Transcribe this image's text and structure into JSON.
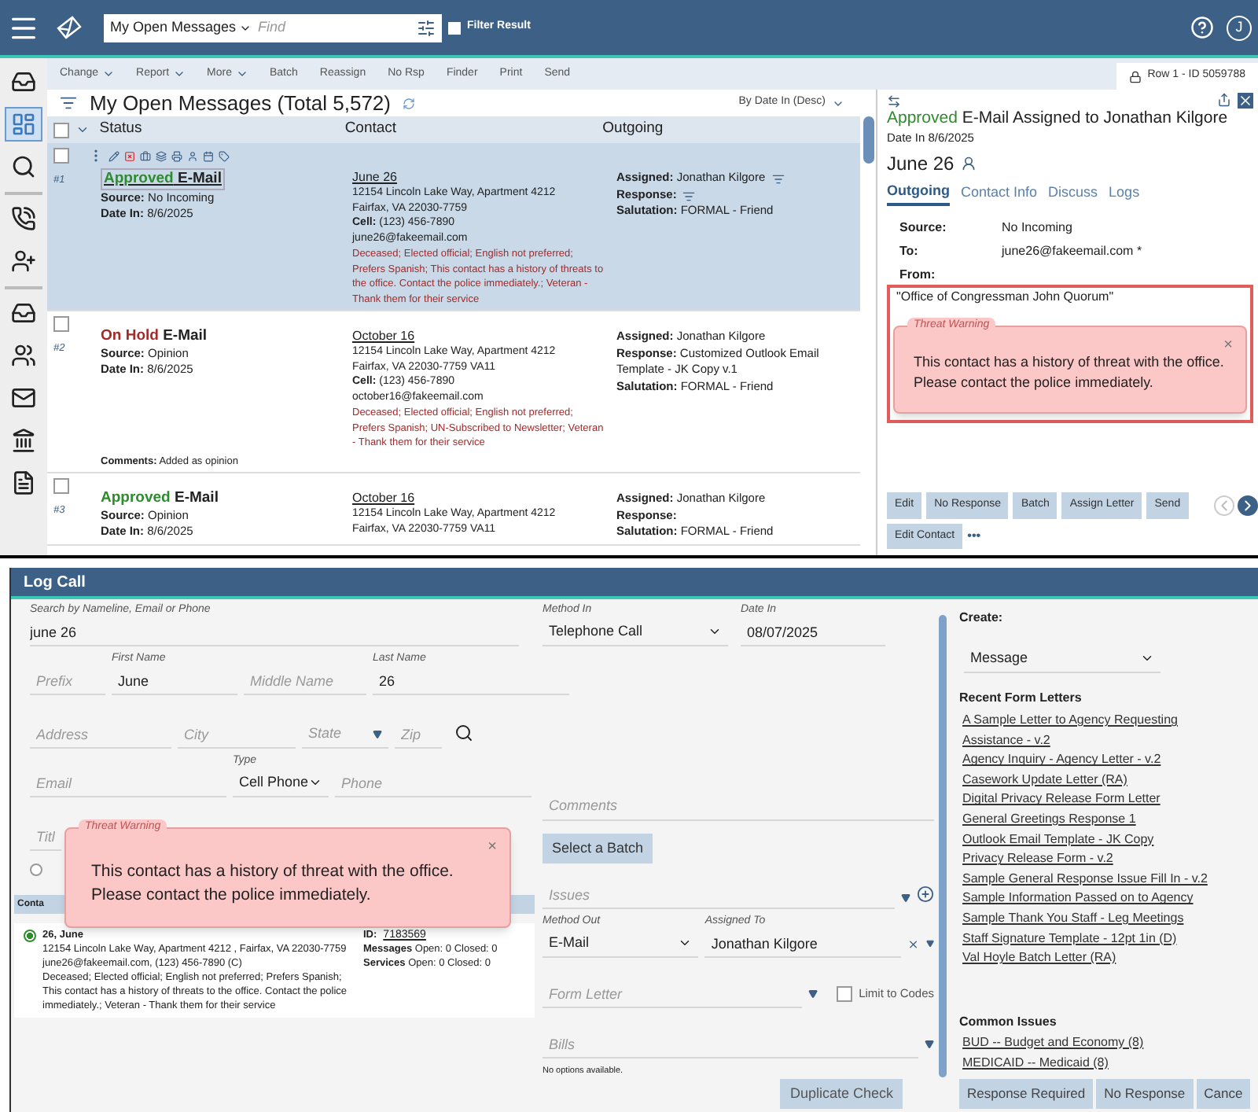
{
  "app_bar": {
    "view": "My Open Messages",
    "search_placeholder": "Find",
    "filter_result": {
      "label": "Filter Result",
      "checked": false
    },
    "user_initial": "J"
  },
  "sidebar": [
    {
      "kind": "inbox",
      "selected": false,
      "divider": false
    },
    {
      "kind": "dashboard",
      "selected": true,
      "divider": false
    },
    {
      "kind": "search",
      "selected": false,
      "divider": false
    },
    {
      "kind": "phone",
      "selected": false,
      "divider": true
    },
    {
      "kind": "add-user",
      "selected": false,
      "divider": false
    },
    {
      "kind": "inbox",
      "selected": false,
      "divider": true
    },
    {
      "kind": "users",
      "selected": false,
      "divider": false
    },
    {
      "kind": "mail",
      "selected": false,
      "divider": false
    },
    {
      "kind": "bank",
      "selected": false,
      "divider": false
    },
    {
      "kind": "document",
      "selected": false,
      "divider": false
    }
  ],
  "toolbar": [
    {
      "label": "Change",
      "menu": true
    },
    {
      "label": "Report",
      "menu": true
    },
    {
      "label": "More",
      "menu": true
    },
    {
      "label": "Batch",
      "menu": false
    },
    {
      "label": "Reassign",
      "menu": false
    },
    {
      "label": "No Rsp",
      "menu": false
    },
    {
      "label": "Finder",
      "menu": false
    },
    {
      "label": "Print",
      "menu": false
    },
    {
      "label": "Send",
      "menu": false
    }
  ],
  "row_indicator": "Row 1 - ID 5059788",
  "list": {
    "title": "My Open Messages (Total 5,572)",
    "sort": "By Date In (Desc)",
    "select_all_checked": false,
    "columns": [
      "Status",
      "Contact",
      "Outgoing"
    ],
    "rows": [
      {
        "number": "#1",
        "selected": true,
        "checked": false,
        "status": "Approved",
        "color": "#2e8b2e",
        "type": "E-Mail",
        "status_fields": [
          {
            "label": "Source:",
            "value": "No Incoming"
          },
          {
            "label": "Date In:",
            "value": "8/6/2025"
          }
        ],
        "contact": "June 26",
        "lines": [
          "12154 Lincoln Lake Way, Apartment 4212",
          "Fairfax, VA 22030-7759"
        ],
        "cell": {
          "label": "Cell:",
          "value": "(123) 456-7890"
        },
        "email": "june26@fakeemail.com",
        "notes": "Deceased; Elected official; English not preferred; Prefers Spanish; This contact has a history of threats to the office. Contact the police immediately.; Veteran - Thank them for their service",
        "outgoing": [
          {
            "label": "Assigned:",
            "value": "Jonathan Kilgore",
            "filter": true
          },
          {
            "label": "Response:",
            "filter": true
          },
          {
            "label": "Salutation:",
            "value": "FORMAL - Friend",
            "filter": false
          }
        ]
      },
      {
        "number": "#2",
        "selected": false,
        "checked": false,
        "status": "On Hold",
        "color": "#a52a2a",
        "type": "E-Mail",
        "status_fields": [
          {
            "label": "Source:",
            "value": "Opinion"
          },
          {
            "label": "Date In:",
            "value": "8/6/2025"
          }
        ],
        "contact": "October 16",
        "lines": [
          "12154 Lincoln Lake Way, Apartment 4212",
          "Fairfax, VA 22030-7759  VA11"
        ],
        "cell": {
          "label": "Cell:",
          "value": "(123) 456-7890"
        },
        "email": "october16@fakeemail.com",
        "notes": "Deceased; Elected official; English not preferred; Prefers Spanish; UN-Subscribed to Newsletter; Veteran - Thank them for their service",
        "outgoing": [
          {
            "label": "Assigned:",
            "value": "Jonathan Kilgore",
            "filter": false
          },
          {
            "label": "Response:",
            "value": "Customized Outlook Email Template - JK Copy v.1",
            "filter": false
          },
          {
            "label": "Salutation:",
            "value": "FORMAL - Friend",
            "filter": false
          }
        ],
        "comments": {
          "label": "Comments:",
          "value": "Added as opinion"
        }
      },
      {
        "number": "#3",
        "selected": false,
        "checked": false,
        "status": "Approved",
        "color": "#2e8b2e",
        "type": "E-Mail",
        "status_fields": [
          {
            "label": "Source:",
            "value": "Opinion"
          },
          {
            "label": "Date In:",
            "value": "8/6/2025"
          }
        ],
        "contact": "October 16",
        "lines": [
          "12154 Lincoln Lake Way, Apartment 4212",
          "Fairfax, VA 22030-7759  VA11"
        ],
        "outgoing": [
          {
            "label": "Assigned:",
            "value": "Jonathan Kilgore",
            "filter": false
          },
          {
            "label": "Response:",
            "filter": false
          },
          {
            "label": "Salutation:",
            "value": "FORMAL - Friend",
            "filter": false
          }
        ]
      }
    ]
  },
  "detail": {
    "status": "Approved",
    "color": "#2e8b2e",
    "heading": "E-Mail Assigned to Jonathan Kilgore",
    "date_in": "Date In 8/6/2025",
    "contact": "June 26",
    "tabs": [
      {
        "label": "Outgoing",
        "selected": true
      },
      {
        "label": "Contact Info",
        "selected": false
      },
      {
        "label": "Discuss",
        "selected": false
      },
      {
        "label": "Logs",
        "selected": false
      }
    ],
    "fields": [
      {
        "label": "Source:",
        "value": "No Incoming"
      },
      {
        "label": "To:",
        "value": "june26@fakeemail.com *"
      },
      {
        "label": "From:"
      }
    ],
    "sender": "\"Office of Congressman John Quorum\"",
    "warning": {
      "legend": "Threat Warning",
      "message": "This contact has a history of threat with the office. Please contact the police immediately.",
      "close": "×"
    },
    "buttons": [
      "Edit",
      "No Response",
      "Batch",
      "Assign Letter",
      "Send",
      "Edit Contact"
    ],
    "more": "•••",
    "prev_disabled": true,
    "next_disabled": false
  },
  "log_call": {
    "title": "Log Call",
    "search": {
      "label": "Search by Nameline, Email or Phone",
      "value": "june 26"
    },
    "prefix": {
      "placeholder": "Prefix"
    },
    "first_name": {
      "label": "First Name",
      "value": "June"
    },
    "middle_name": {
      "placeholder": "Middle Name"
    },
    "last_name": {
      "label": "Last Name",
      "value": "26"
    },
    "address": {
      "placeholder": "Address"
    },
    "city": {
      "placeholder": "City"
    },
    "state": {
      "placeholder": "State"
    },
    "zip": {
      "placeholder": "Zip"
    },
    "email": {
      "placeholder": "Email"
    },
    "type": {
      "label": "Type",
      "value": "Cell Phone"
    },
    "phone": {
      "placeholder": "Phone"
    },
    "title_field": {
      "placeholder": "Titl"
    },
    "option_radio": {
      "selected": false
    },
    "results_header": "Conta",
    "results": [
      {
        "selected": true,
        "name": "26, June",
        "lines": [
          "12154 Lincoln Lake Way, Apartment 4212 , Fairfax, VA 22030-7759",
          "june26@fakeemail.com, (123) 456-7890 (C)",
          "Deceased; Elected official; English not preferred; Prefers Spanish; This contact has a history of threats to the office. Contact the police immediately.; Veteran - Thank them for their service"
        ],
        "id_label": "ID:",
        "id": "7183569",
        "stats": [
          {
            "label": "Messages",
            "value": "Open: 0 Closed: 0"
          },
          {
            "label": "Services",
            "value": "Open: 0 Closed: 0"
          }
        ]
      }
    ],
    "warning": {
      "legend": "Threat Warning",
      "message": "This contact has a history of threat with the office. Please contact the police immediately.",
      "close": "×"
    },
    "method_in": {
      "label": "Method In",
      "value": "Telephone Call"
    },
    "date_in": {
      "label": "Date In",
      "value": "08/07/2025"
    },
    "comments": {
      "placeholder": "Comments"
    },
    "select_batch": "Select a Batch",
    "issues": {
      "placeholder": "Issues"
    },
    "method_out": {
      "label": "Method Out",
      "value": "E-Mail"
    },
    "assigned_to": {
      "label": "Assigned To",
      "value": "Jonathan Kilgore"
    },
    "form_letter": {
      "placeholder": "Form Letter"
    },
    "limit_to_codes": {
      "label": "Limit to Codes",
      "checked": false
    },
    "bills": {
      "placeholder": "Bills"
    },
    "no_options": "No options available.",
    "duplicate_check": "Duplicate Check",
    "create": {
      "label": "Create:",
      "value": "Message"
    },
    "recent_title": "Recent Form Letters",
    "recent_letters": [
      "A Sample Letter to Agency Requesting Assistance - v.2",
      "Agency Inquiry - Agency Letter - v.2",
      "Casework Update Letter (RA)",
      "Digital Privacy Release Form Letter",
      "General Greetings Response 1",
      "Outlook Email Template - JK Copy",
      "Privacy Release Form - v.2",
      "Sample General Response Issue Fill In - v.2",
      "Sample Information Passed on to Agency",
      "Sample Thank You Staff - Leg Meetings",
      "Staff Signature Template - 12pt 1in (D)",
      "Val Hoyle Batch Letter (RA)"
    ],
    "issues_title": "Common Issues",
    "common_issues": [
      "BUD -- Budget and Economy (8)",
      "MEDICAID -- Medicaid (8)"
    ],
    "actions": [
      "Response Required",
      "No Response",
      "Cance"
    ]
  }
}
